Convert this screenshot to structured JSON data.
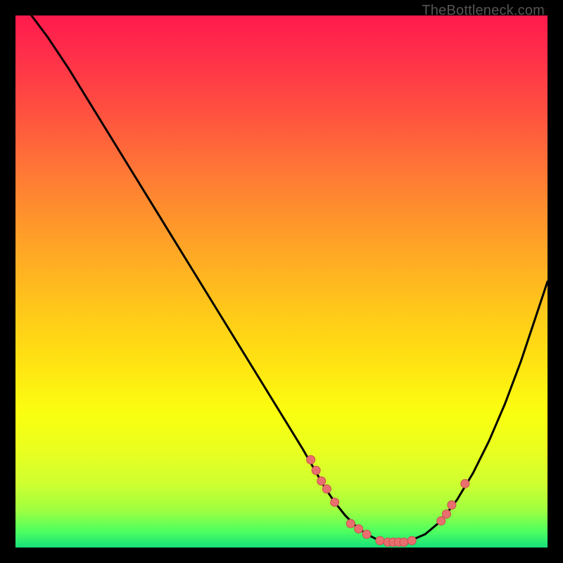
{
  "watermark": "TheBottleneck.com",
  "colors": {
    "background": "#000000",
    "curve": "#000000",
    "marker_fill": "#e96f6f",
    "marker_stroke": "#c94f4f"
  },
  "chart_data": {
    "type": "line",
    "title": "",
    "xlabel": "",
    "ylabel": "",
    "xlim": [
      0,
      100
    ],
    "ylim": [
      0,
      100
    ],
    "series": [
      {
        "name": "bottleneck-curve",
        "x": [
          3,
          6,
          10,
          14,
          18,
          22,
          26,
          30,
          34,
          38,
          42,
          46,
          50,
          54,
          56,
          58,
          60,
          62,
          64,
          66,
          68,
          71,
          74,
          77,
          80,
          83,
          86,
          89,
          92,
          95,
          98,
          100
        ],
        "values": [
          100,
          96,
          90,
          83.5,
          77,
          70.5,
          64,
          57.5,
          51,
          44.5,
          38,
          31.5,
          25,
          18.5,
          15,
          11.5,
          8.5,
          6,
          4,
          2.5,
          1.5,
          1,
          1.2,
          2.5,
          5,
          9,
          14,
          20,
          27,
          35,
          44,
          50
        ]
      }
    ],
    "markers": {
      "name": "highlight-points",
      "x": [
        55.5,
        56.5,
        57.5,
        58.5,
        60.0,
        63.0,
        64.5,
        66.0,
        68.5,
        70.0,
        71.0,
        72.0,
        73.0,
        74.5,
        80.0,
        81.0,
        82.0,
        84.5
      ],
      "values": [
        16.5,
        14.5,
        12.5,
        11.0,
        8.5,
        4.5,
        3.5,
        2.5,
        1.3,
        1.0,
        1.0,
        1.0,
        1.0,
        1.3,
        5.0,
        6.3,
        8.0,
        12.0
      ]
    }
  }
}
